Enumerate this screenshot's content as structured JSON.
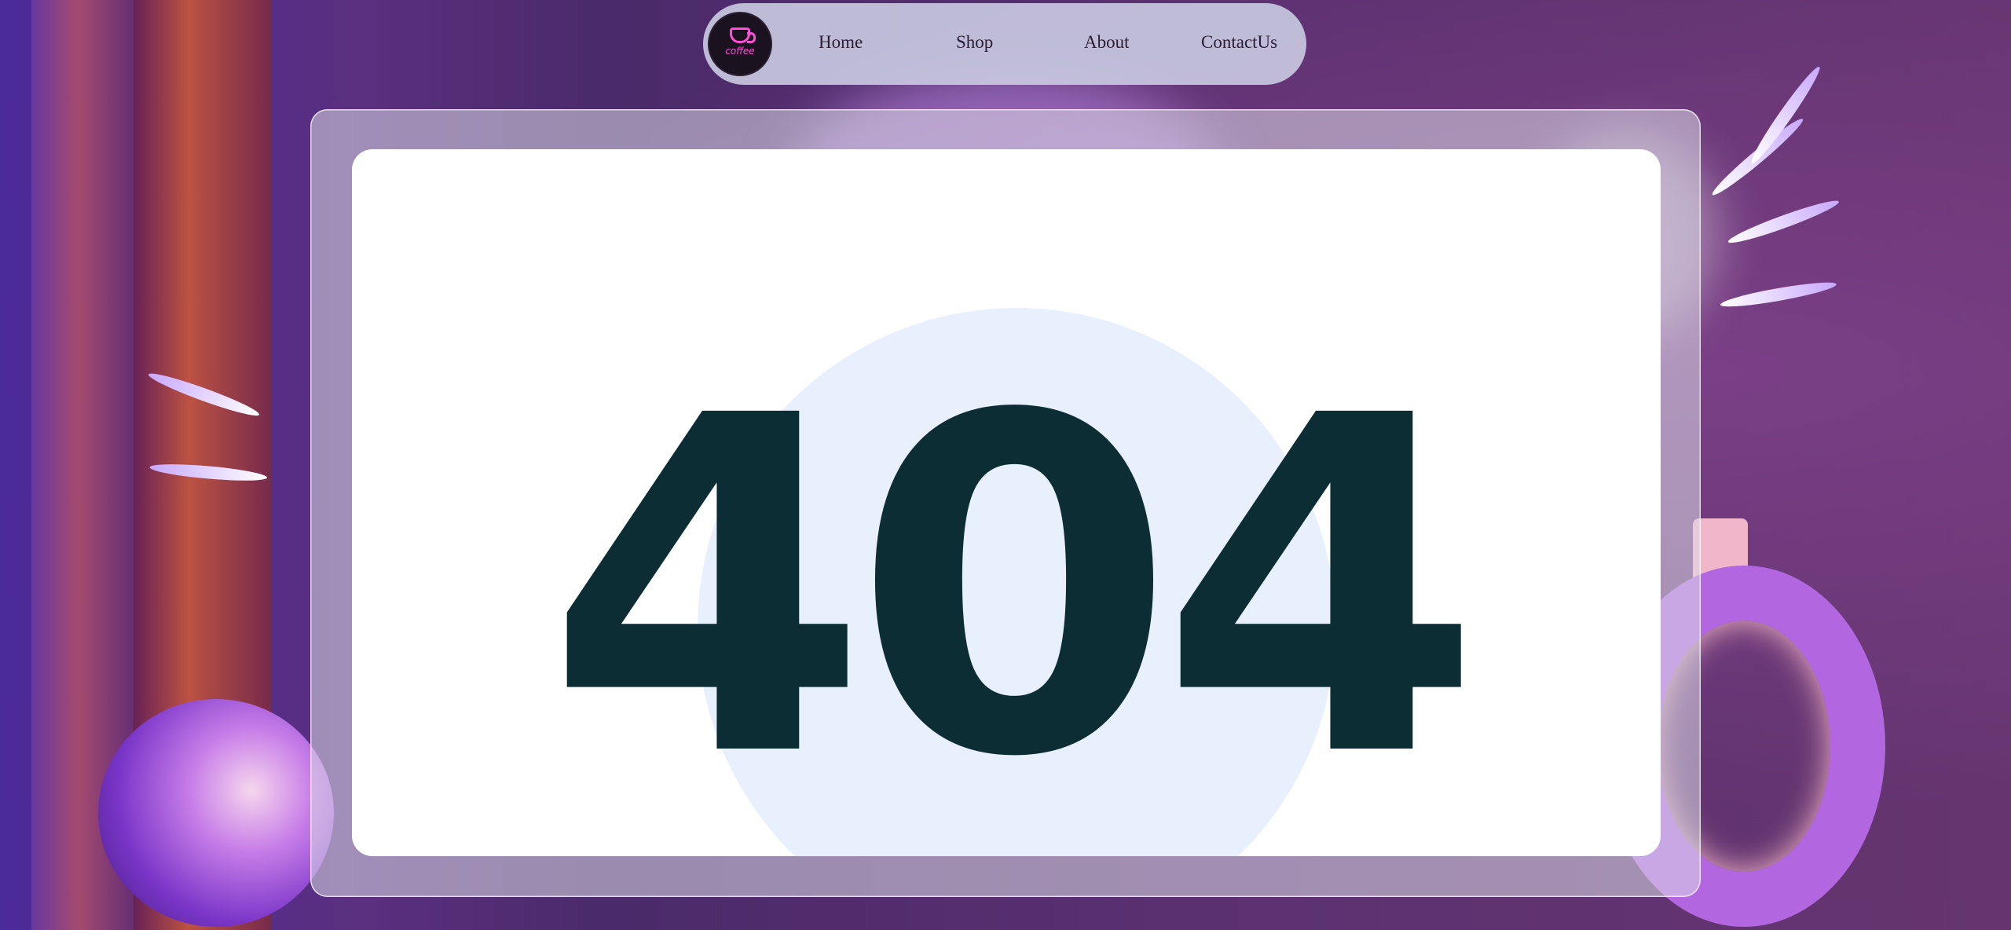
{
  "nav": {
    "logo_text": "coffee",
    "links": [
      {
        "label": "Home"
      },
      {
        "label": "Shop"
      },
      {
        "label": "About"
      },
      {
        "label": "ContactUs"
      }
    ]
  },
  "error": {
    "code": "404"
  },
  "colors": {
    "code_text": "#0b2d33",
    "circle": "#e8effd",
    "logo_accent": "#ff4fd8",
    "nav_bg": "#c8c8e1"
  },
  "icons": [
    "coffee-cup-icon"
  ]
}
